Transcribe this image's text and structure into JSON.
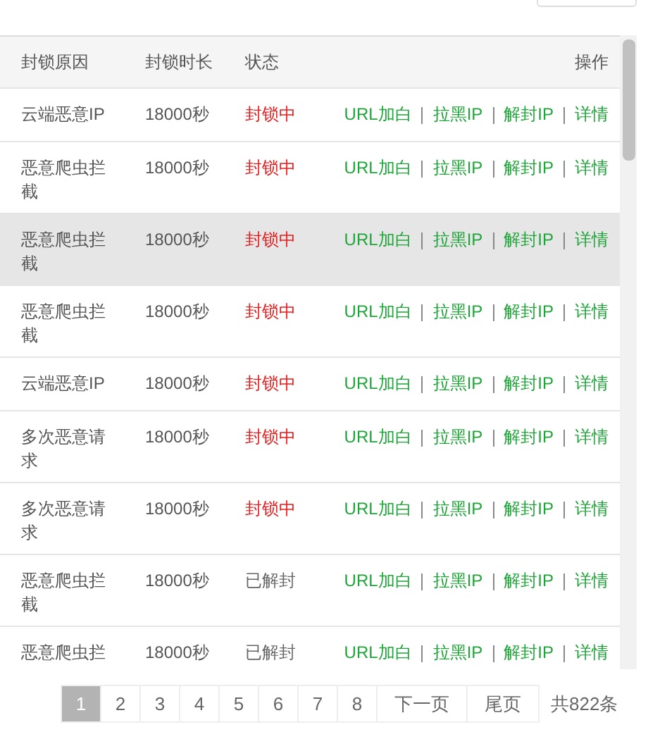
{
  "table": {
    "columns": [
      "封锁原因",
      "封锁时长",
      "状态",
      "操作"
    ],
    "rows": [
      {
        "reason": "云端恶意IP",
        "duration": "18000秒",
        "status": "封锁中",
        "blocked": true,
        "selected": false,
        "actions": [
          "URL加白",
          "拉黑IP",
          "解封IP",
          "详情"
        ]
      },
      {
        "reason": "恶意爬虫拦截",
        "duration": "18000秒",
        "status": "封锁中",
        "blocked": true,
        "selected": false,
        "actions": [
          "URL加白",
          "拉黑IP",
          "解封IP",
          "详情"
        ]
      },
      {
        "reason": "恶意爬虫拦截",
        "duration": "18000秒",
        "status": "封锁中",
        "blocked": true,
        "selected": true,
        "actions": [
          "URL加白",
          "拉黑IP",
          "解封IP",
          "详情"
        ]
      },
      {
        "reason": "恶意爬虫拦截",
        "duration": "18000秒",
        "status": "封锁中",
        "blocked": true,
        "selected": false,
        "actions": [
          "URL加白",
          "拉黑IP",
          "解封IP",
          "详情"
        ]
      },
      {
        "reason": "云端恶意IP",
        "duration": "18000秒",
        "status": "封锁中",
        "blocked": true,
        "selected": false,
        "actions": [
          "URL加白",
          "拉黑IP",
          "解封IP",
          "详情"
        ]
      },
      {
        "reason": "多次恶意请求",
        "duration": "18000秒",
        "status": "封锁中",
        "blocked": true,
        "selected": false,
        "actions": [
          "URL加白",
          "拉黑IP",
          "解封IP",
          "详情"
        ]
      },
      {
        "reason": "多次恶意请求",
        "duration": "18000秒",
        "status": "封锁中",
        "blocked": true,
        "selected": false,
        "actions": [
          "URL加白",
          "拉黑IP",
          "解封IP",
          "详情"
        ]
      },
      {
        "reason": "恶意爬虫拦截",
        "duration": "18000秒",
        "status": "已解封",
        "blocked": false,
        "selected": false,
        "actions": [
          "URL加白",
          "拉黑IP",
          "解封IP",
          "详情"
        ]
      },
      {
        "reason": "恶意爬虫拦",
        "duration": "18000秒",
        "status": "已解封",
        "blocked": false,
        "selected": false,
        "actions": [
          "URL加白",
          "拉黑IP",
          "解封IP",
          "详情"
        ]
      }
    ]
  },
  "pagination": {
    "pages": [
      {
        "label": "1",
        "selected": true
      },
      {
        "label": "2",
        "selected": false
      },
      {
        "label": "3",
        "selected": false
      },
      {
        "label": "4",
        "selected": false
      },
      {
        "label": "5",
        "selected": false
      },
      {
        "label": "6",
        "selected": false
      },
      {
        "label": "7",
        "selected": false
      },
      {
        "label": "8",
        "selected": false
      }
    ],
    "next": "下一页",
    "last": "尾页",
    "total": "共822条"
  }
}
